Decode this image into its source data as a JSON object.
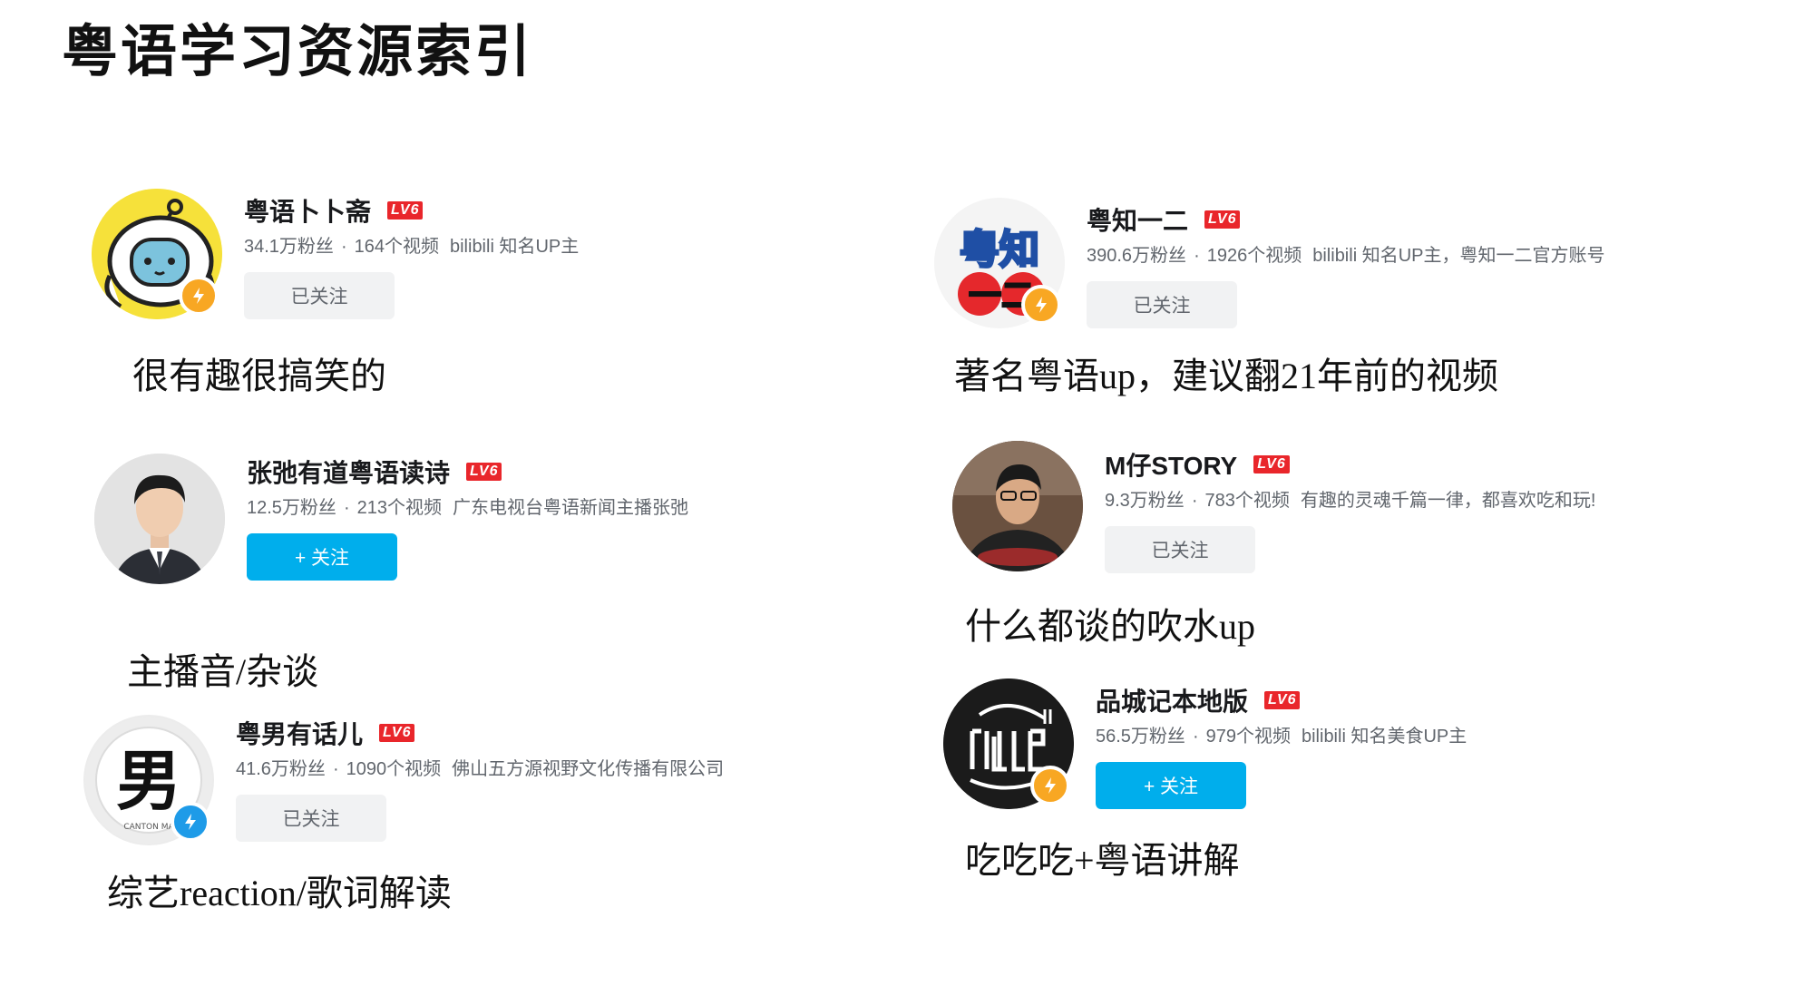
{
  "page": {
    "title": "粤语学习资源索引"
  },
  "channels": [
    {
      "name": "粤语卜卜斋",
      "level": "LV6",
      "fans": "34.1万粉丝",
      "videos": "164个视频",
      "description": "bilibili 知名UP主",
      "follow_label": "已关注",
      "followed": true,
      "badge_color": "#f8a723",
      "avatar_icon": "cartoon-robot-icon",
      "comment": "很有趣很搞笑的"
    },
    {
      "name": "张弛有道粤语读诗",
      "level": "LV6",
      "fans": "12.5万粉丝",
      "videos": "213个视频",
      "description": "广东电视台粤语新闻主播张弛",
      "follow_label": "+ 关注",
      "followed": false,
      "avatar_icon": "man-portrait-icon",
      "comment": "主播音/杂谈"
    },
    {
      "name": "粤男有话儿",
      "level": "LV6",
      "fans": "41.6万粉丝",
      "videos": "1090个视频",
      "description": "佛山五方源视野文化传播有限公司",
      "follow_label": "已关注",
      "followed": true,
      "badge_color": "#1e9be8",
      "avatar_icon": "nan-character-logo-icon",
      "avatar_caption": "CANTON MA",
      "avatar_glyph": "男",
      "comment": "综艺reaction/歌词解读"
    },
    {
      "name": "粤知一二",
      "level": "LV6",
      "fans": "390.6万粉丝",
      "videos": "1926个视频",
      "description": "bilibili 知名UP主，粤知一二官方账号",
      "follow_label": "已关注",
      "followed": true,
      "badge_color": "#f8a723",
      "avatar_icon": "yuezhi-logo-icon",
      "avatar_glyph": "粤知",
      "avatar_glyph2": "一二",
      "comment": "著名粤语up，建议翻21年前的视频"
    },
    {
      "name": "M仔STORY",
      "level": "LV6",
      "fans": "9.3万粉丝",
      "videos": "783个视频",
      "description": "有趣的灵魂千篇一律，都喜欢吃和玩!",
      "follow_label": "已关注",
      "followed": true,
      "avatar_icon": "man-eating-photo-icon",
      "comment": "什么都谈的吹水up"
    },
    {
      "name": "品城记本地版",
      "level": "LV6",
      "fans": "56.5万粉丝",
      "videos": "979个视频",
      "description": "bilibili 知名美食UP主",
      "follow_label": "+ 关注",
      "followed": false,
      "badge_color": "#f8a723",
      "avatar_icon": "city-fork-logo-icon",
      "comment": "吃吃吃+粤语讲解"
    }
  ],
  "stat_separator": "·"
}
